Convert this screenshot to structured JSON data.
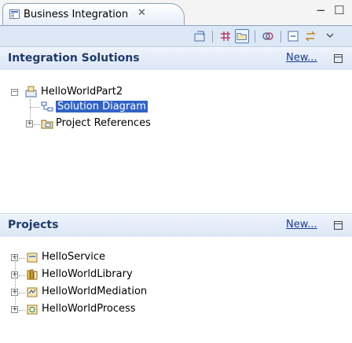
{
  "view": {
    "tab_title": "Business Integration",
    "tab_close": "✕",
    "minimize": "−",
    "maximize": "☐"
  },
  "solutions": {
    "title": "Integration Solutions",
    "new_link": "New...",
    "root": {
      "label": "HelloWorldPart2",
      "expander": "−",
      "children": [
        {
          "label": "Solution Diagram",
          "selected": true
        },
        {
          "label": "Project References",
          "expander": "+"
        }
      ]
    }
  },
  "projects": {
    "title": "Projects",
    "new_link": "New...",
    "items": [
      {
        "label": "HelloService",
        "expander": "+"
      },
      {
        "label": "HelloWorldLibrary",
        "expander": "+"
      },
      {
        "label": "HelloWorldMediation",
        "expander": "+"
      },
      {
        "label": "HelloWorldProcess",
        "expander": "+"
      }
    ]
  },
  "colors": {
    "accent": "#3163c5",
    "header_text": "#1f3b6b",
    "link": "#1a3c8c"
  }
}
